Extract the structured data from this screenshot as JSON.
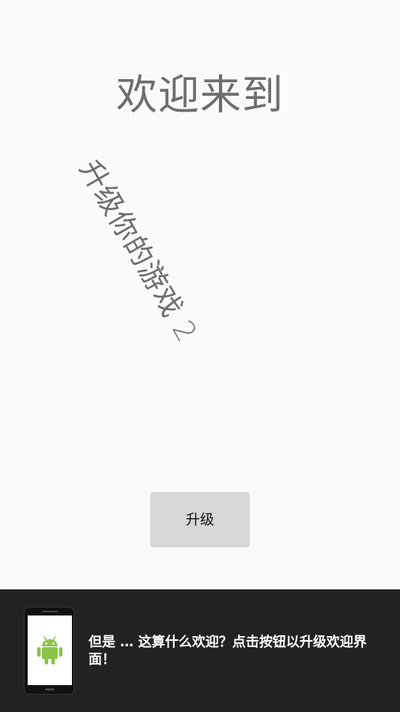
{
  "welcome": {
    "title": "欢迎来到",
    "subtitle": "升级你的游戏 2"
  },
  "upgrade_button": {
    "label": "升级"
  },
  "bottom_banner": {
    "message": "但是 … 这算什么欢迎？点击按钮以升级欢迎界面！",
    "icon": "android-robot-icon",
    "icon_color": "#8bc34a"
  },
  "colors": {
    "background": "#fafafa",
    "text_gray": "#6e6e6e",
    "button_bg": "#d7d7d7",
    "banner_bg": "#222222"
  }
}
